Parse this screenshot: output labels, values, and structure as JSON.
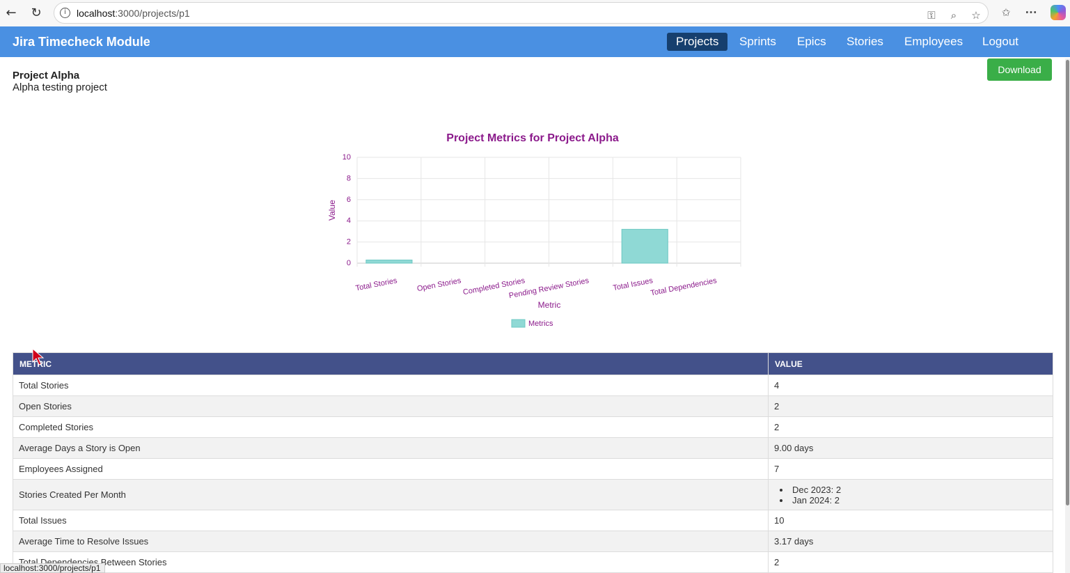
{
  "browser": {
    "url_host": "localhost",
    "url_path": ":3000/projects/p1",
    "status_link": "localhost:3000/projects/p1"
  },
  "navbar": {
    "brand": "Jira Timecheck Module",
    "items": [
      {
        "label": "Projects",
        "active": true
      },
      {
        "label": "Sprints",
        "active": false
      },
      {
        "label": "Epics",
        "active": false
      },
      {
        "label": "Stories",
        "active": false
      },
      {
        "label": "Employees",
        "active": false
      },
      {
        "label": "Logout",
        "active": false
      }
    ]
  },
  "project": {
    "name": "Project Alpha",
    "description": "Alpha testing project",
    "download_label": "Download"
  },
  "chart_data": {
    "type": "bar",
    "title": "Project Metrics for Project Alpha",
    "xlabel": "Metric",
    "ylabel": "Value",
    "ylim": [
      0,
      10
    ],
    "yticks": [
      0,
      2,
      4,
      6,
      8,
      10
    ],
    "categories": [
      "Total Stories",
      "Open Stories",
      "Completed Stories",
      "Pending Review Stories",
      "Total Issues",
      "Total Dependencies"
    ],
    "series": [
      {
        "name": "Metrics",
        "values": [
          0.3,
          0,
          0,
          0,
          3.2,
          0
        ],
        "color": "#8fd9d5"
      }
    ],
    "grid": true,
    "legend": "bottom"
  },
  "table": {
    "headers": [
      "METRIC",
      "VALUE"
    ],
    "rows": [
      {
        "metric": "Total Stories",
        "value": "4"
      },
      {
        "metric": "Open Stories",
        "value": "2"
      },
      {
        "metric": "Completed Stories",
        "value": "2"
      },
      {
        "metric": "Average Days a Story is Open",
        "value": "9.00 days"
      },
      {
        "metric": "Employees Assigned",
        "value": "7"
      },
      {
        "metric": "Stories Created Per Month",
        "list": [
          "Dec 2023: 2",
          "Jan 2024: 2"
        ]
      },
      {
        "metric": "Total Issues",
        "value": "10"
      },
      {
        "metric": "Average Time to Resolve Issues",
        "value": "3.17 days"
      },
      {
        "metric": "Total Dependencies Between Stories",
        "value": "2"
      }
    ]
  },
  "colors": {
    "navbar": "#4a90e2",
    "active_nav": "#163f6e",
    "download": "#3aae48",
    "table_header": "#43518a",
    "chart_text": "#8b1a8b"
  }
}
